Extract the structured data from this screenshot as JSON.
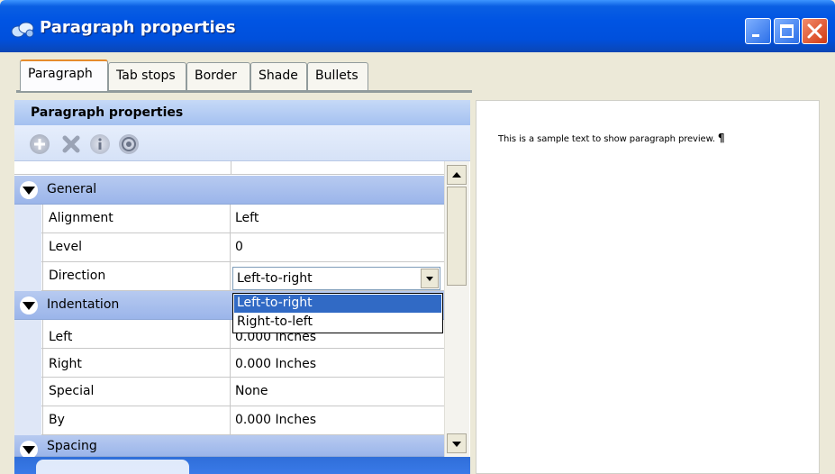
{
  "window": {
    "title": "Paragraph properties",
    "controls": [
      "minimize",
      "maximize",
      "close"
    ]
  },
  "tabs": [
    {
      "label": "Paragraph",
      "active": true
    },
    {
      "label": "Tab stops",
      "active": false
    },
    {
      "label": "Border",
      "active": false
    },
    {
      "label": "Shade",
      "active": false
    },
    {
      "label": "Bullets",
      "active": false
    }
  ],
  "panel": {
    "header": "Paragraph properties",
    "toolbar_icons": [
      "add-icon",
      "delete-icon",
      "info-icon",
      "help-icon"
    ]
  },
  "grid": {
    "categories": {
      "general": "General",
      "indentation": "Indentation",
      "spacing": "Spacing"
    },
    "rows": {
      "alignment": {
        "name": "Alignment",
        "value": "Left"
      },
      "level": {
        "name": "Level",
        "value": "0"
      },
      "direction": {
        "name": "Direction",
        "value": "Left-to-right"
      },
      "left": {
        "name": "Left",
        "value": "0.000 Inches"
      },
      "right": {
        "name": "Right",
        "value": "0.000 Inches"
      },
      "special": {
        "name": "Special",
        "value": "None"
      },
      "by": {
        "name": "By",
        "value": "0.000 Inches"
      }
    }
  },
  "direction_dropdown": {
    "options": [
      "Left-to-right",
      "Right-to-left"
    ],
    "selected": "Left-to-right"
  },
  "preview": {
    "text": "This is a sample text to show paragraph preview.",
    "mark": "¶"
  },
  "colors": {
    "titlebar": "#0054e3",
    "category_band": "#a9c0ee",
    "selection": "#316ac5",
    "tab_accent": "#e68b2c"
  }
}
